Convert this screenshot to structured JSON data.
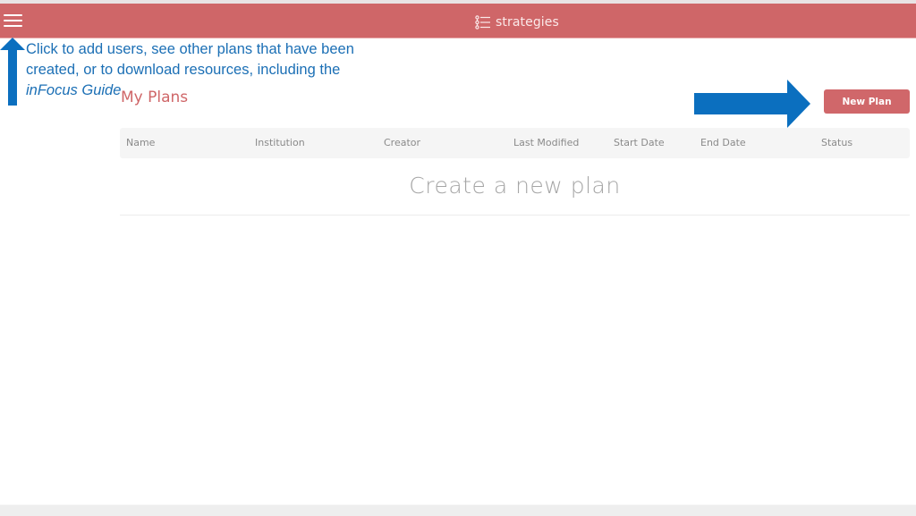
{
  "header": {
    "brand_label": "strategies",
    "brand_icon": "list-tree-icon",
    "menu_icon": "hamburger-menu-icon",
    "background_color": "#cf6668"
  },
  "annotation": {
    "line1": "Click to add users, see other plans that have been",
    "line2": "created, or to download resources, including the",
    "line3_italic": "inFocus Guide",
    "text_color": "#1b6fb5",
    "arrow_color": "#0b6fbf"
  },
  "main": {
    "title": "My Plans",
    "new_plan_button": "New Plan",
    "table": {
      "columns": [
        "Name",
        "Institution",
        "Creator",
        "Last Modified",
        "Start Date",
        "End Date",
        "Status"
      ]
    },
    "empty_message": "Create a new plan"
  }
}
